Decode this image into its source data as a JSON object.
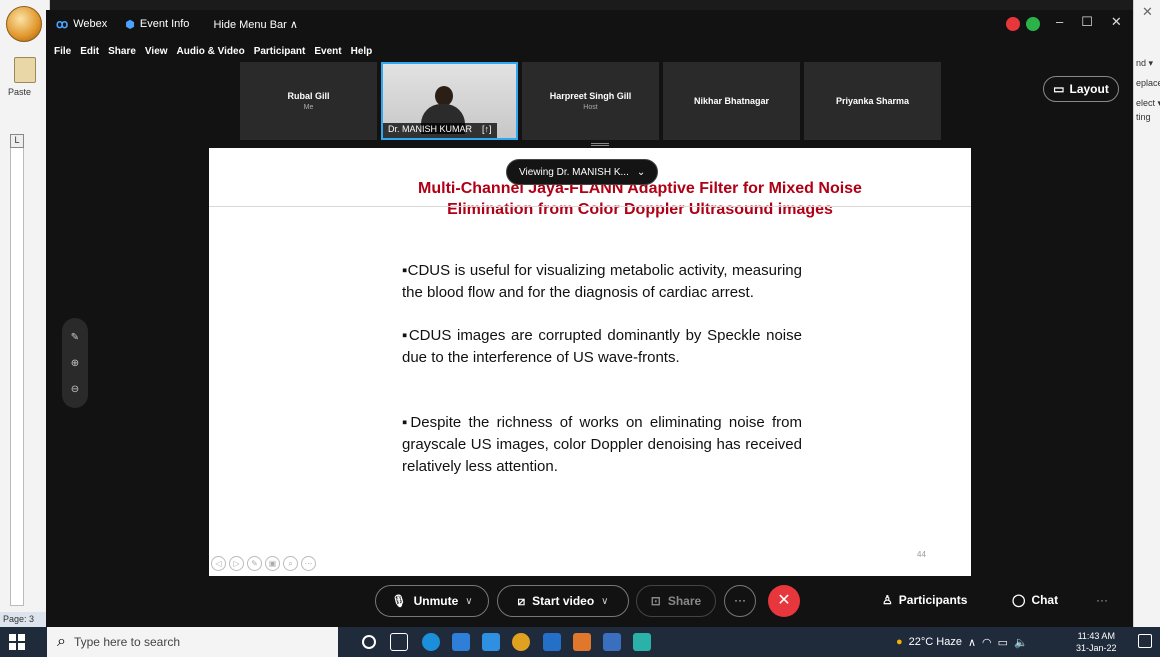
{
  "word": {
    "paste_label": "Paste",
    "ruler_corner": "L",
    "status_page": "Page: 3",
    "right_items": [
      "nd ▾",
      "eplace",
      "elect ▾",
      "ting"
    ]
  },
  "webex": {
    "app_name": "Webex",
    "event_info": "Event Info",
    "hide_menu": "Hide Menu Bar ∧",
    "menu": [
      "File",
      "Edit",
      "Share",
      "View",
      "Audio & Video",
      "Participant",
      "Event",
      "Help"
    ],
    "window_controls": [
      "–",
      "☐",
      "✕"
    ],
    "colors": {
      "accent": "#2ea8f2",
      "record": "#e8363d",
      "signal": "#2bb34a",
      "title": "#b00016"
    }
  },
  "participants": [
    {
      "name": "Rubal Gill",
      "sub": "Me"
    },
    {
      "name": "Dr. MANISH KUMAR",
      "sub": "",
      "active": true
    },
    {
      "name": "Harpreet Singh Gill",
      "sub": "Host"
    },
    {
      "name": "Nikhar Bhatnagar",
      "sub": ""
    },
    {
      "name": "Priyanka Sharma",
      "sub": ""
    }
  ],
  "layout_label": "Layout",
  "viewing_label": "Viewing Dr. MANISH K...",
  "slide": {
    "title_line1": "Multi-Channel Jaya-FLANN Adaptive Filter for Mixed Noise",
    "title_line2": "Elimination from Color Doppler Ultrasound images",
    "bullets": [
      "▪CDUS is useful for visualizing metabolic activity, measuring the blood flow and for the diagnosis of cardiac arrest.",
      "▪CDUS images are corrupted dominantly by Speckle noise due to the interference of US wave-fronts.",
      "▪Despite the richness of works on eliminating noise from grayscale US images, color Doppler denoising has received relatively less attention."
    ],
    "number": "44"
  },
  "controls": {
    "unmute": "Unmute",
    "start_video": "Start video",
    "share": "Share",
    "participants": "Participants",
    "chat": "Chat"
  },
  "taskbar": {
    "search_placeholder": "Type here to search",
    "weather": "22°C  Haze",
    "time": "11:43 AM",
    "date": "31-Jan-22"
  }
}
